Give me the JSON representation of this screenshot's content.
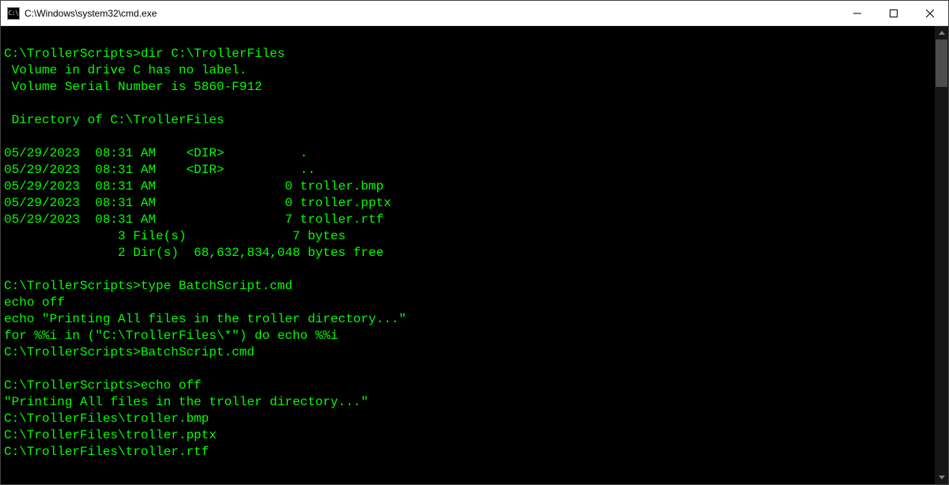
{
  "window": {
    "title": "C:\\Windows\\system32\\cmd.exe",
    "icon_label": "cmd-icon"
  },
  "terminal": {
    "lines": [
      "",
      "C:\\TrollerScripts>dir C:\\TrollerFiles",
      " Volume in drive C has no label.",
      " Volume Serial Number is 5860-F912",
      "",
      " Directory of C:\\TrollerFiles",
      "",
      "05/29/2023  08:31 AM    <DIR>          .",
      "05/29/2023  08:31 AM    <DIR>          ..",
      "05/29/2023  08:31 AM                 0 troller.bmp",
      "05/29/2023  08:31 AM                 0 troller.pptx",
      "05/29/2023  08:31 AM                 7 troller.rtf",
      "               3 File(s)              7 bytes",
      "               2 Dir(s)  68,632,834,048 bytes free",
      "",
      "C:\\TrollerScripts>type BatchScript.cmd",
      "echo off",
      "echo \"Printing All files in the troller directory...\"",
      "for %%i in (\"C:\\TrollerFiles\\*\") do echo %%i",
      "C:\\TrollerScripts>BatchScript.cmd",
      "",
      "C:\\TrollerScripts>echo off",
      "\"Printing All files in the troller directory...\"",
      "C:\\TrollerFiles\\troller.bmp",
      "C:\\TrollerFiles\\troller.pptx",
      "C:\\TrollerFiles\\troller.rtf"
    ]
  }
}
